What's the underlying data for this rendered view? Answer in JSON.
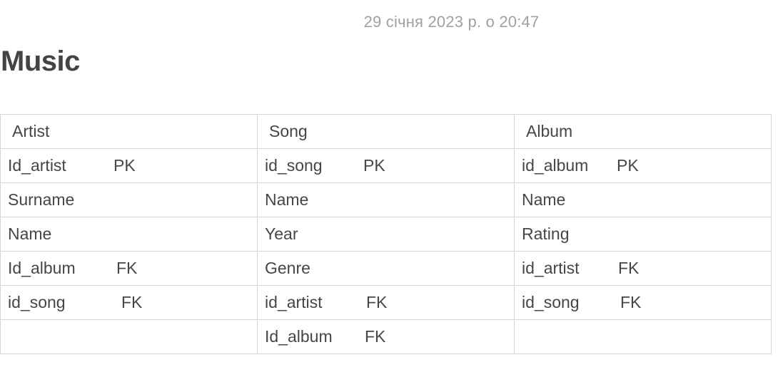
{
  "note": {
    "timestamp": "29 січня 2023 р. о 20:47",
    "title": "Music"
  },
  "table": {
    "headers": [
      "Artist",
      "Song",
      "Album"
    ],
    "rows": [
      [
        {
          "name": "Id_artist",
          "key": "PK"
        },
        {
          "name": "id_song",
          "key": "PK"
        },
        {
          "name": "id_album",
          "key": "PK"
        }
      ],
      [
        {
          "name": "Surname",
          "key": ""
        },
        {
          "name": "Name",
          "key": ""
        },
        {
          "name": "Name",
          "key": ""
        }
      ],
      [
        {
          "name": "Name",
          "key": ""
        },
        {
          "name": "Year",
          "key": ""
        },
        {
          "name": "Rating",
          "key": ""
        }
      ],
      [
        {
          "name": "Id_album",
          "key": "FK"
        },
        {
          "name": "Genre",
          "key": ""
        },
        {
          "name": "id_artist",
          "key": "FK"
        }
      ],
      [
        {
          "name": "id_song",
          "key": "FK"
        },
        {
          "name": "id_artist",
          "key": "FK"
        },
        {
          "name": "id_song",
          "key": "FK"
        }
      ],
      [
        {
          "name": "",
          "key": ""
        },
        {
          "name": "Id_album",
          "key": "FK"
        },
        {
          "name": "",
          "key": ""
        }
      ]
    ]
  }
}
